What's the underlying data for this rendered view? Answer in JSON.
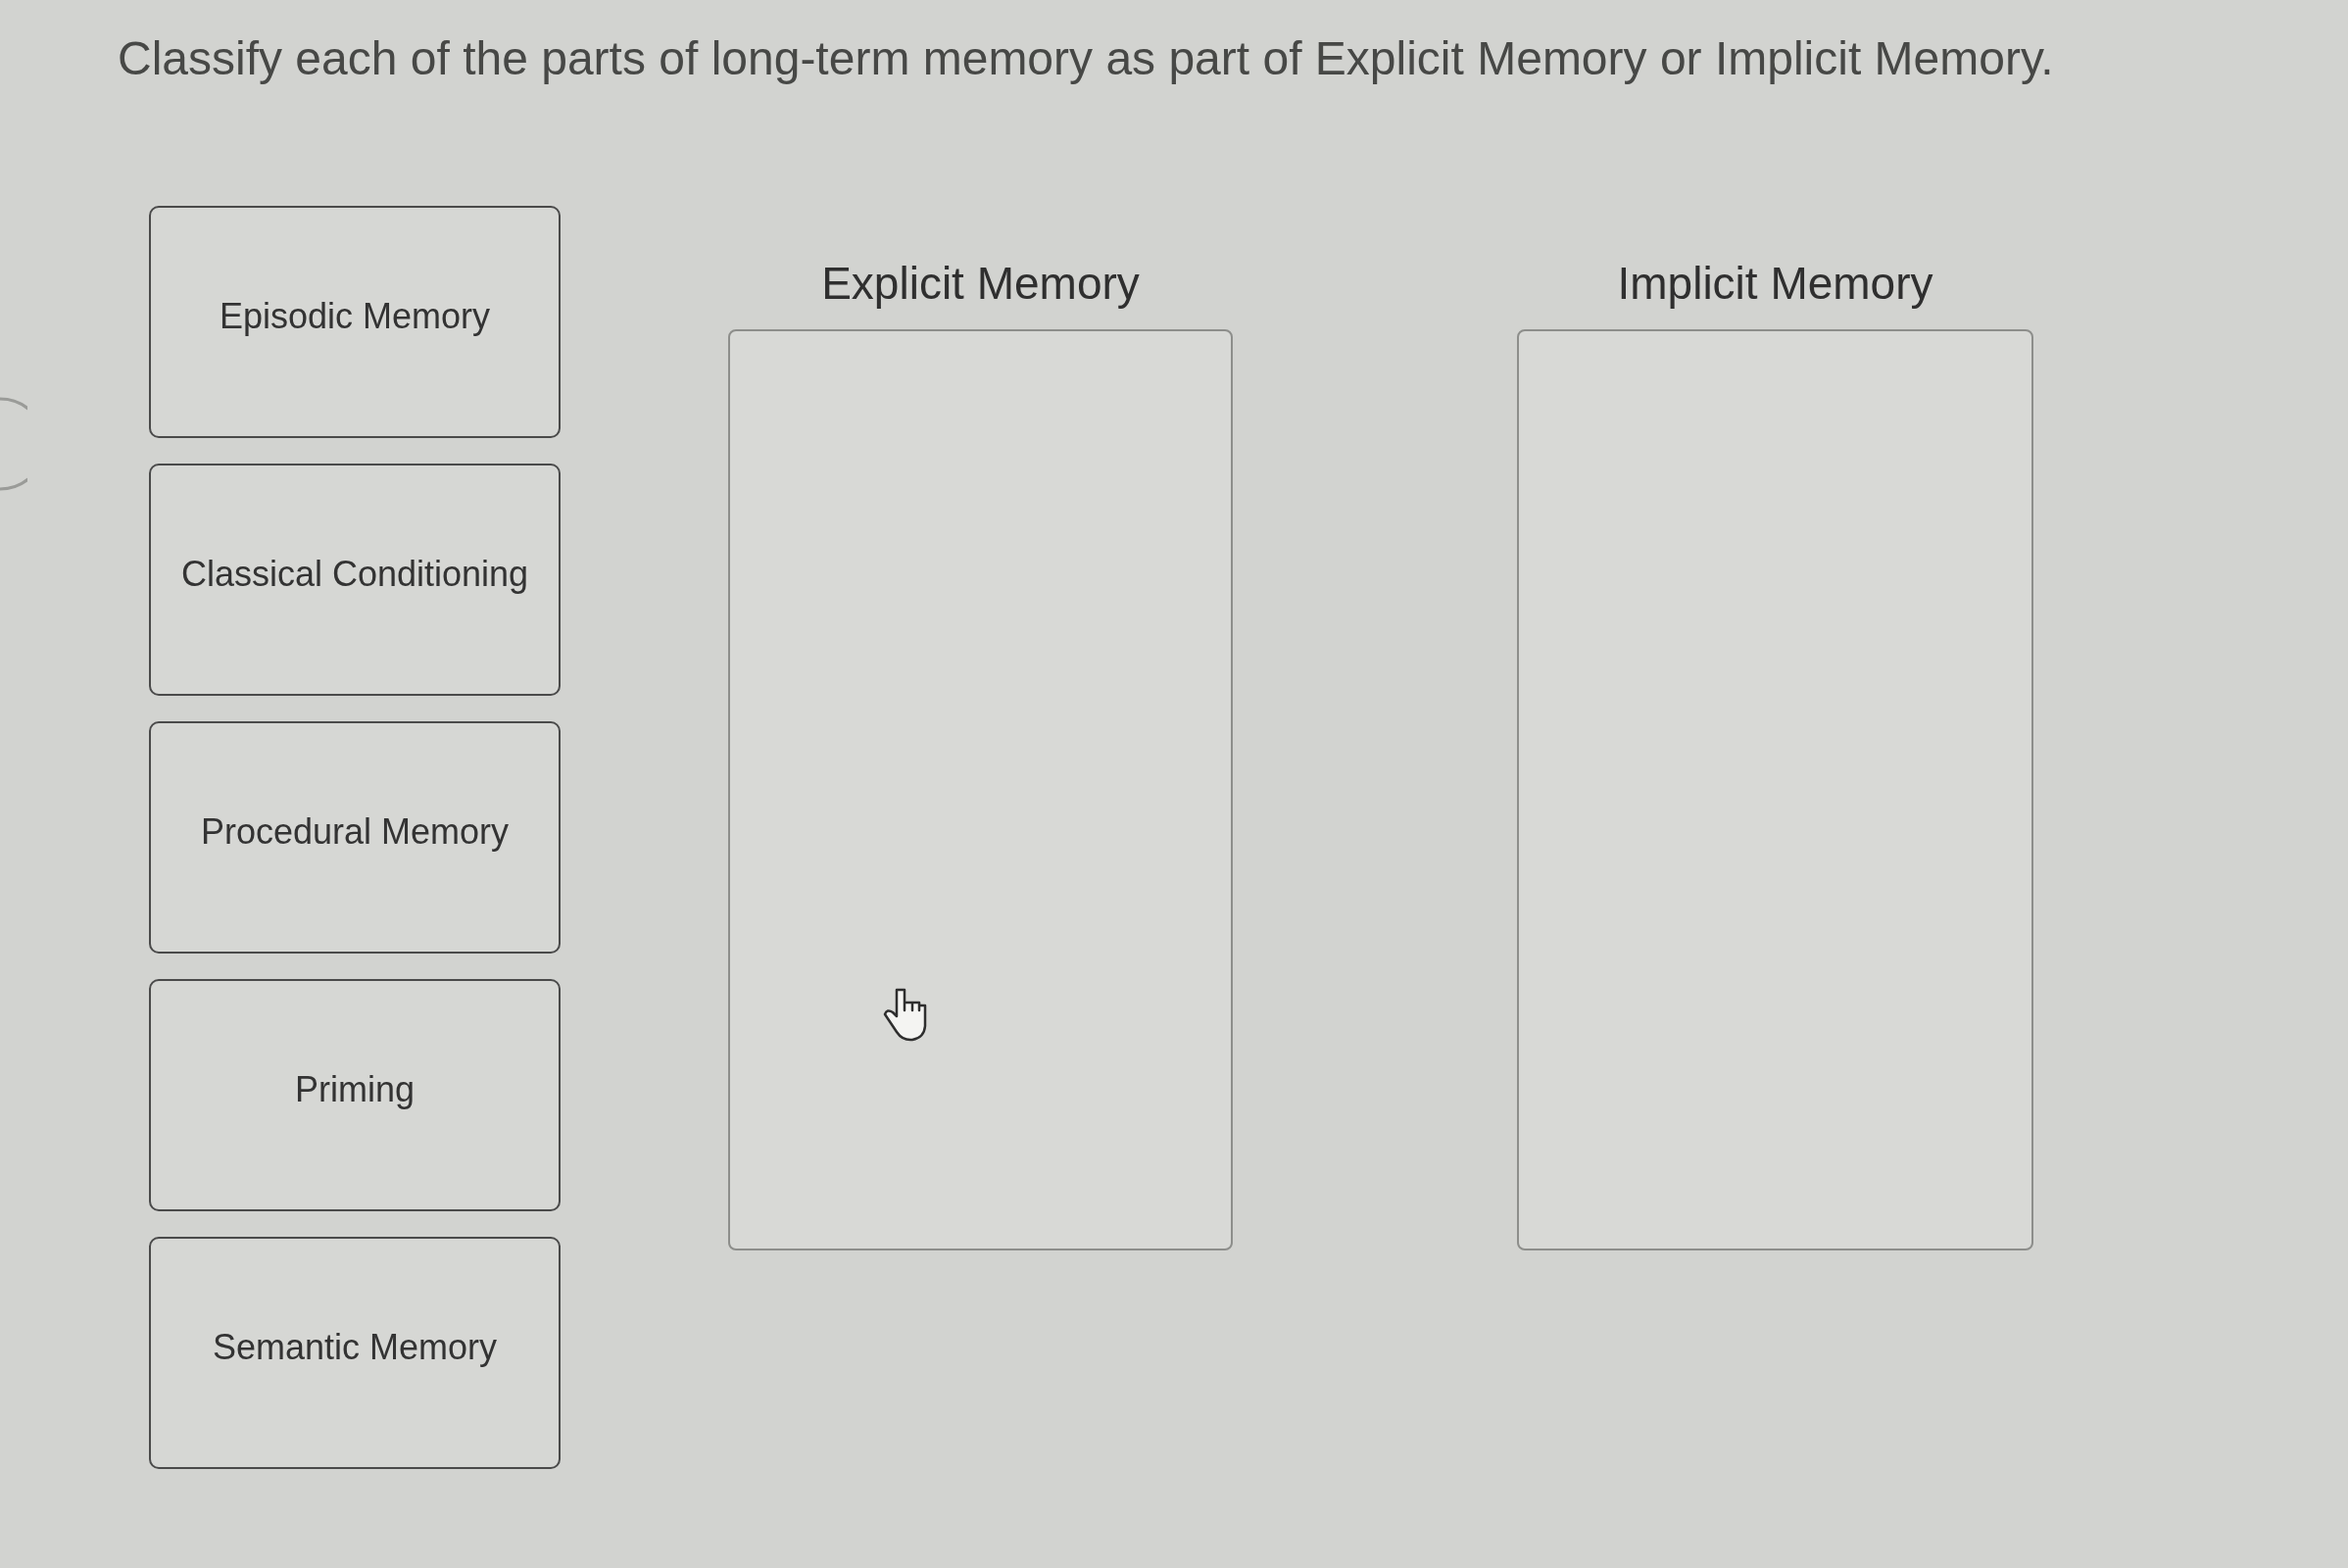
{
  "question": "Classify each of the parts of long-term memory as part of Explicit Memory or Implicit Memory.",
  "cards": [
    {
      "label": "Episodic Memory"
    },
    {
      "label": "Classical Conditioning"
    },
    {
      "label": "Procedural Memory"
    },
    {
      "label": "Priming"
    },
    {
      "label": "Semantic Memory"
    }
  ],
  "bins": [
    {
      "title": "Explicit Memory"
    },
    {
      "title": "Implicit Memory"
    }
  ]
}
